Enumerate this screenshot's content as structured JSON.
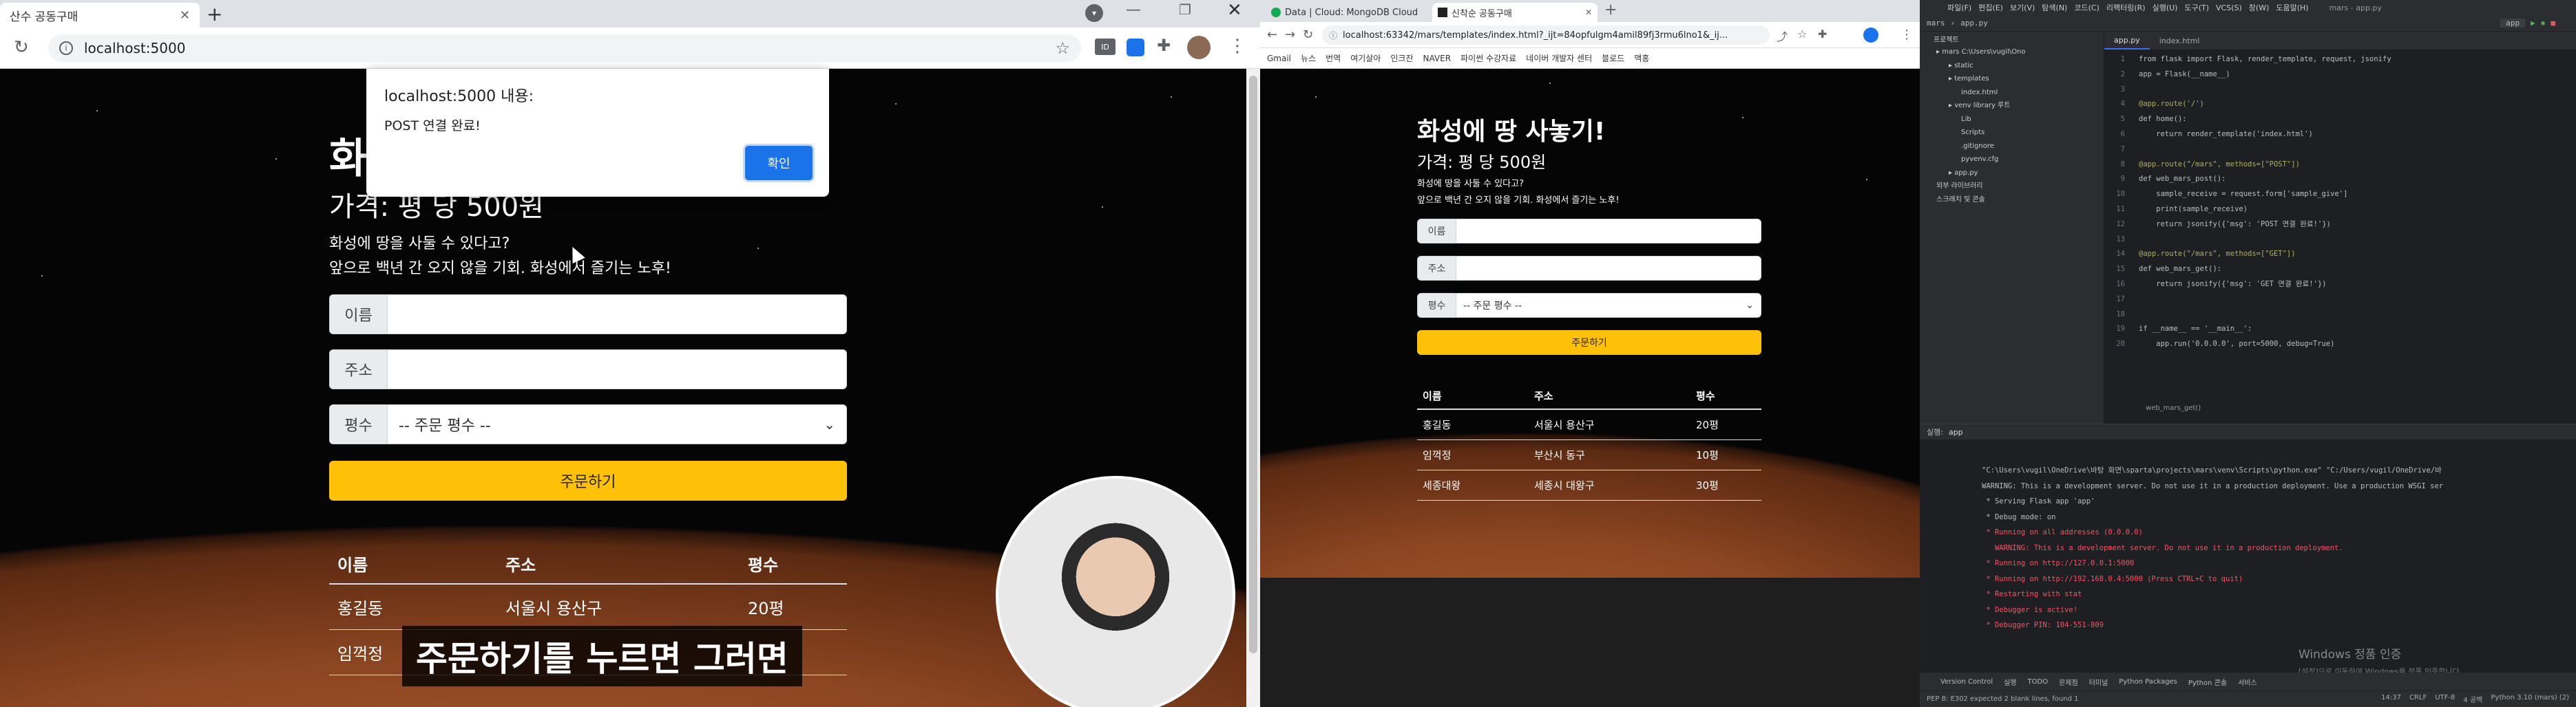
{
  "left_browser": {
    "tab_title": "산수 공동구매",
    "url": "localhost:5000",
    "alert": {
      "title": "localhost:5000 내용:",
      "message": "POST 연결 완료!",
      "ok_label": "확인"
    },
    "page": {
      "title": "화",
      "price": "가격: 평 당 500원",
      "desc1": "화성에 땅을 사둘 수 있다고?",
      "desc2": "앞으로 백년 간 오지 않을 기회. 화성에서 즐기는 노후!",
      "name_label": "이름",
      "addr_label": "주소",
      "size_label": "평수",
      "size_option": "-- 주문 평수 --",
      "order_button": "주문하기",
      "table_headers": [
        "이름",
        "주소",
        "평수"
      ],
      "rows": [
        [
          "홍길동",
          "서울시 용산구",
          "20평"
        ],
        [
          "임꺽정",
          "",
          ""
        ]
      ]
    },
    "subtitle": "주문하기를 누르면 그러면"
  },
  "middle_browser": {
    "tabs": [
      "Data | Cloud: MongoDB Cloud",
      "신착순 공동구매"
    ],
    "url": "localhost:63342/mars/templates/index.html?_ijt=84opfulgm4amil89fj3rmu6lno1&_ij...",
    "bookmarks": [
      "Gmail",
      "뉴스",
      "번역",
      "여기살아",
      "인크잔",
      "NAVER",
      "파이썬 수강자료",
      "네이버 개발자 센터",
      "블로드",
      "맥홍"
    ],
    "page": {
      "title": "화성에 땅 사놓기!",
      "price": "가격: 평 당 500원",
      "desc1": "화성에 땅을 사둘 수 있다고?",
      "desc2": "앞으로 백년 간 오지 않을 기회. 화성에서 즐기는 노후!",
      "name_label": "이름",
      "addr_label": "주소",
      "size_label": "평수",
      "size_option": "-- 주문 평수 --",
      "order_button": "주문하기",
      "table_headers": [
        "이름",
        "주소",
        "평수"
      ],
      "rows": [
        [
          "홍길동",
          "서울시 용산구",
          "20평"
        ],
        [
          "임꺽정",
          "부산시 동구",
          "10평"
        ],
        [
          "세종대왕",
          "세종시 대왕구",
          "30평"
        ]
      ]
    }
  },
  "ide": {
    "menu": [
      "파일(F)",
      "편집(E)",
      "보기(V)",
      "탐색(N)",
      "코드(C)",
      "리팩터링(R)",
      "실행(U)",
      "도구(T)",
      "VCS(S)",
      "창(W)",
      "도움말(H)"
    ],
    "window_title": "mars - app.py",
    "breadcrumb": [
      "mars",
      "app.py"
    ],
    "run_config": "app",
    "project_label": "프로젝트",
    "file_tabs": [
      "app.py",
      "index.html"
    ],
    "tree": [
      {
        "label": "mars  C:\\Users\\vugil\\Ono",
        "depth": 0
      },
      {
        "label": "static",
        "depth": 1
      },
      {
        "label": "templates",
        "depth": 1
      },
      {
        "label": "index.html",
        "depth": 2
      },
      {
        "label": "venv  library 루트",
        "depth": 1
      },
      {
        "label": "Lib",
        "depth": 2
      },
      {
        "label": "Scripts",
        "depth": 2
      },
      {
        "label": ".gitignore",
        "depth": 2
      },
      {
        "label": "pyvenv.cfg",
        "depth": 2
      },
      {
        "label": "app.py",
        "depth": 1
      },
      {
        "label": "외부 라이브러리",
        "depth": 0
      },
      {
        "label": "스크래치 및 콘솔",
        "depth": 0
      }
    ],
    "code_lines": [
      "from flask import Flask, render_template, request, jsonify",
      "app = Flask(__name__)",
      "",
      "@app.route('/')",
      "def home():",
      "    return render_template('index.html')",
      "",
      "@app.route(\"/mars\", methods=[\"POST\"])",
      "def web_mars_post():",
      "    sample_receive = request.form['sample_give']",
      "    print(sample_receive)",
      "    return jsonify({'msg': 'POST 연결 완료!'})",
      "",
      "@app.route(\"/mars\", methods=[\"GET\"])",
      "def web_mars_get():",
      "    return jsonify({'msg': 'GET 연결 완료!'})",
      "",
      "",
      "if __name__ == '__main__':",
      "    app.run('0.0.0.0', port=5000, debug=True)"
    ],
    "code_footer": "web_mars_get()",
    "run_tab_label": "실행:",
    "run_tab_name": "app",
    "console_lines": [
      {
        "text": "\"C:\\Users\\vugil\\OneDrive\\바탕 화면\\sparta\\projects\\mars\\venv\\Scripts\\python.exe\" \"C:/Users/vugil/OneDrive/바",
        "style": "plain"
      },
      {
        "text": "WARNING: This is a development server. Do not use it in a production deployment. Use a production WSGI ser",
        "style": "plain"
      },
      {
        "text": " * Serving Flask app 'app'",
        "style": "plain"
      },
      {
        "text": " * Debug mode: on",
        "style": "plain"
      },
      {
        "text": " * Running on all addresses (0.0.0.0)",
        "style": "red"
      },
      {
        "text": "   WARNING: This is a development server. Do not use it in a production deployment.",
        "style": "red"
      },
      {
        "text": " * Running on http://127.0.0.1:5000",
        "style": "red"
      },
      {
        "text": " * Running on http://192.168.0.4:5000 (Press CTRL+C to quit)",
        "style": "red"
      },
      {
        "text": " * Restarting with stat",
        "style": "red"
      },
      {
        "text": " * Debugger is active!",
        "style": "red"
      },
      {
        "text": " * Debugger PIN: 104-551-809",
        "style": "red"
      }
    ],
    "watermark_title": "Windows 정품 인증",
    "watermark_sub": "[설정]으로 이동하여 Windows를 정품 인증합니다.",
    "bottom_tabs": [
      "Version Control",
      "실행",
      "TODO",
      "문제점",
      "터미널",
      "Python Packages",
      "Python 콘솔",
      "서비스"
    ],
    "status_left": "PEP 8: E302 expected 2 blank lines, found 1",
    "status_right": [
      "14:37",
      "CRLF",
      "UTF-8",
      "4 공백",
      "Python 3.10 (mars) (2)"
    ]
  },
  "colors": {
    "accent_yellow": "#ffc107",
    "alert_button": "#1a73e8",
    "ide_bg": "#1e1f22"
  }
}
